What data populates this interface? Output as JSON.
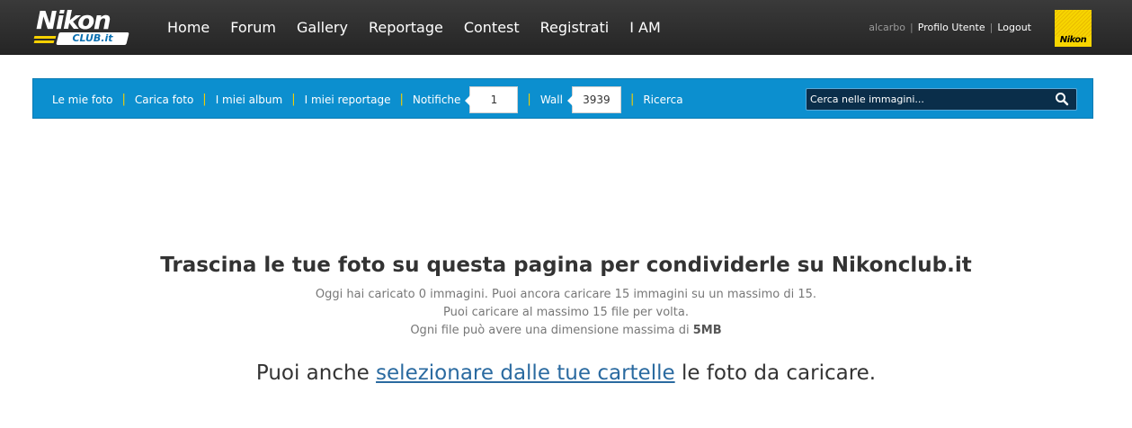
{
  "header": {
    "logo": {
      "main": "Nikon",
      "sub": "CLUB.it"
    },
    "nav": [
      "Home",
      "Forum",
      "Gallery",
      "Reportage",
      "Contest",
      "Registrati",
      "I AM"
    ],
    "user": {
      "username": "alcarbo",
      "profile_label": "Profilo Utente",
      "logout_label": "Logout"
    },
    "brand_badge": "Nikon",
    "colors": {
      "bar": "#2c2c2c",
      "accent_yellow": "#f5d000"
    }
  },
  "subnav": {
    "items": {
      "my_photos": "Le mie foto",
      "upload": "Carica foto",
      "albums": "I miei album",
      "reportages": "I miei reportage",
      "notifications": "Notifiche",
      "notifications_count": "1",
      "wall": "Wall",
      "wall_count": "3939",
      "search": "Ricerca"
    },
    "search": {
      "placeholder": "Cerca nelle immagini...",
      "icon": "search-icon"
    },
    "color": "#0c8fcf"
  },
  "main": {
    "headline": "Trascina le tue foto su questa pagina per condividerle su Nikonclub.it",
    "info_line1": "Oggi hai caricato 0 immagini. Puoi ancora caricare 15 immagini su un massimo di 15.",
    "info_line2": "Puoi caricare al massimo 15 file per volta.",
    "info_line3_prefix": "Ogni file può avere una dimensione massima di",
    "info_line3_size": "5MB",
    "alt_prefix": "Puoi anche",
    "alt_link": "selezionare dalle tue cartelle",
    "alt_suffix": "le foto da caricare."
  }
}
